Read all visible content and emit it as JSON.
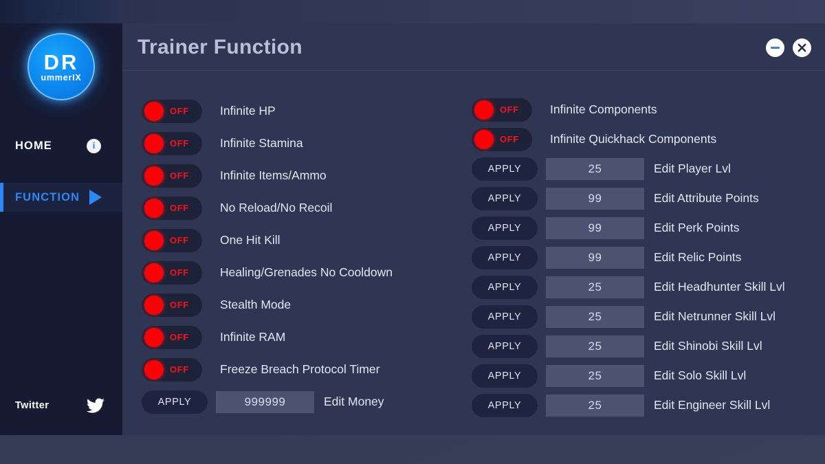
{
  "window": {
    "title": "Trainer Function",
    "minimize_label": "minimize",
    "close_label": "×"
  },
  "sidebar": {
    "logo": {
      "main": "DR",
      "sub": "ummerIX"
    },
    "nav": [
      {
        "label": "HOME",
        "icon": "info-icon",
        "active": false
      },
      {
        "label": "FUNCTION",
        "icon": "play-icon",
        "active": true
      }
    ],
    "footer": {
      "label": "Twitter",
      "icon": "twitter-icon"
    }
  },
  "labels": {
    "off": "OFF",
    "apply": "APPLY"
  },
  "columns": {
    "left": [
      {
        "kind": "toggle",
        "state": "OFF",
        "label": "Infinite HP"
      },
      {
        "kind": "toggle",
        "state": "OFF",
        "label": "Infinite Stamina"
      },
      {
        "kind": "toggle",
        "state": "OFF",
        "label": "Infinite Items/Ammo"
      },
      {
        "kind": "toggle",
        "state": "OFF",
        "label": "No Reload/No Recoil"
      },
      {
        "kind": "toggle",
        "state": "OFF",
        "label": "One Hit Kill"
      },
      {
        "kind": "toggle",
        "state": "OFF",
        "label": "Healing/Grenades No Cooldown"
      },
      {
        "kind": "toggle",
        "state": "OFF",
        "label": "Stealth Mode"
      },
      {
        "kind": "toggle",
        "state": "OFF",
        "label": "Infinite RAM"
      },
      {
        "kind": "toggle",
        "state": "OFF",
        "label": "Freeze Breach Protocol Timer"
      },
      {
        "kind": "field",
        "button": "APPLY",
        "value": "999999",
        "label": "Edit Money"
      }
    ],
    "right": [
      {
        "kind": "toggle",
        "state": "OFF",
        "label": "Infinite Components"
      },
      {
        "kind": "toggle",
        "state": "OFF",
        "label": "Infinite Quickhack Components"
      },
      {
        "kind": "field",
        "button": "APPLY",
        "value": "25",
        "label": "Edit Player Lvl"
      },
      {
        "kind": "field",
        "button": "APPLY",
        "value": "99",
        "label": "Edit Attribute Points"
      },
      {
        "kind": "field",
        "button": "APPLY",
        "value": "99",
        "label": "Edit Perk Points"
      },
      {
        "kind": "field",
        "button": "APPLY",
        "value": "99",
        "label": "Edit Relic Points"
      },
      {
        "kind": "field",
        "button": "APPLY",
        "value": "25",
        "label": "Edit Headhunter Skill Lvl"
      },
      {
        "kind": "field",
        "button": "APPLY",
        "value": "25",
        "label": "Edit Netrunner Skill Lvl"
      },
      {
        "kind": "field",
        "button": "APPLY",
        "value": "25",
        "label": "Edit Shinobi Skill Lvl"
      },
      {
        "kind": "field",
        "button": "APPLY",
        "value": "25",
        "label": "Edit Solo Skill Lvl"
      },
      {
        "kind": "field",
        "button": "APPLY",
        "value": "25",
        "label": "Edit Engineer Skill Lvl"
      }
    ]
  },
  "colors": {
    "accent_blue": "#2f87f5",
    "toggle_red": "#fb0007",
    "panel_bg": "#2f3653",
    "sidebar_bg": "#161b33",
    "field_bg": "#4c5371"
  }
}
